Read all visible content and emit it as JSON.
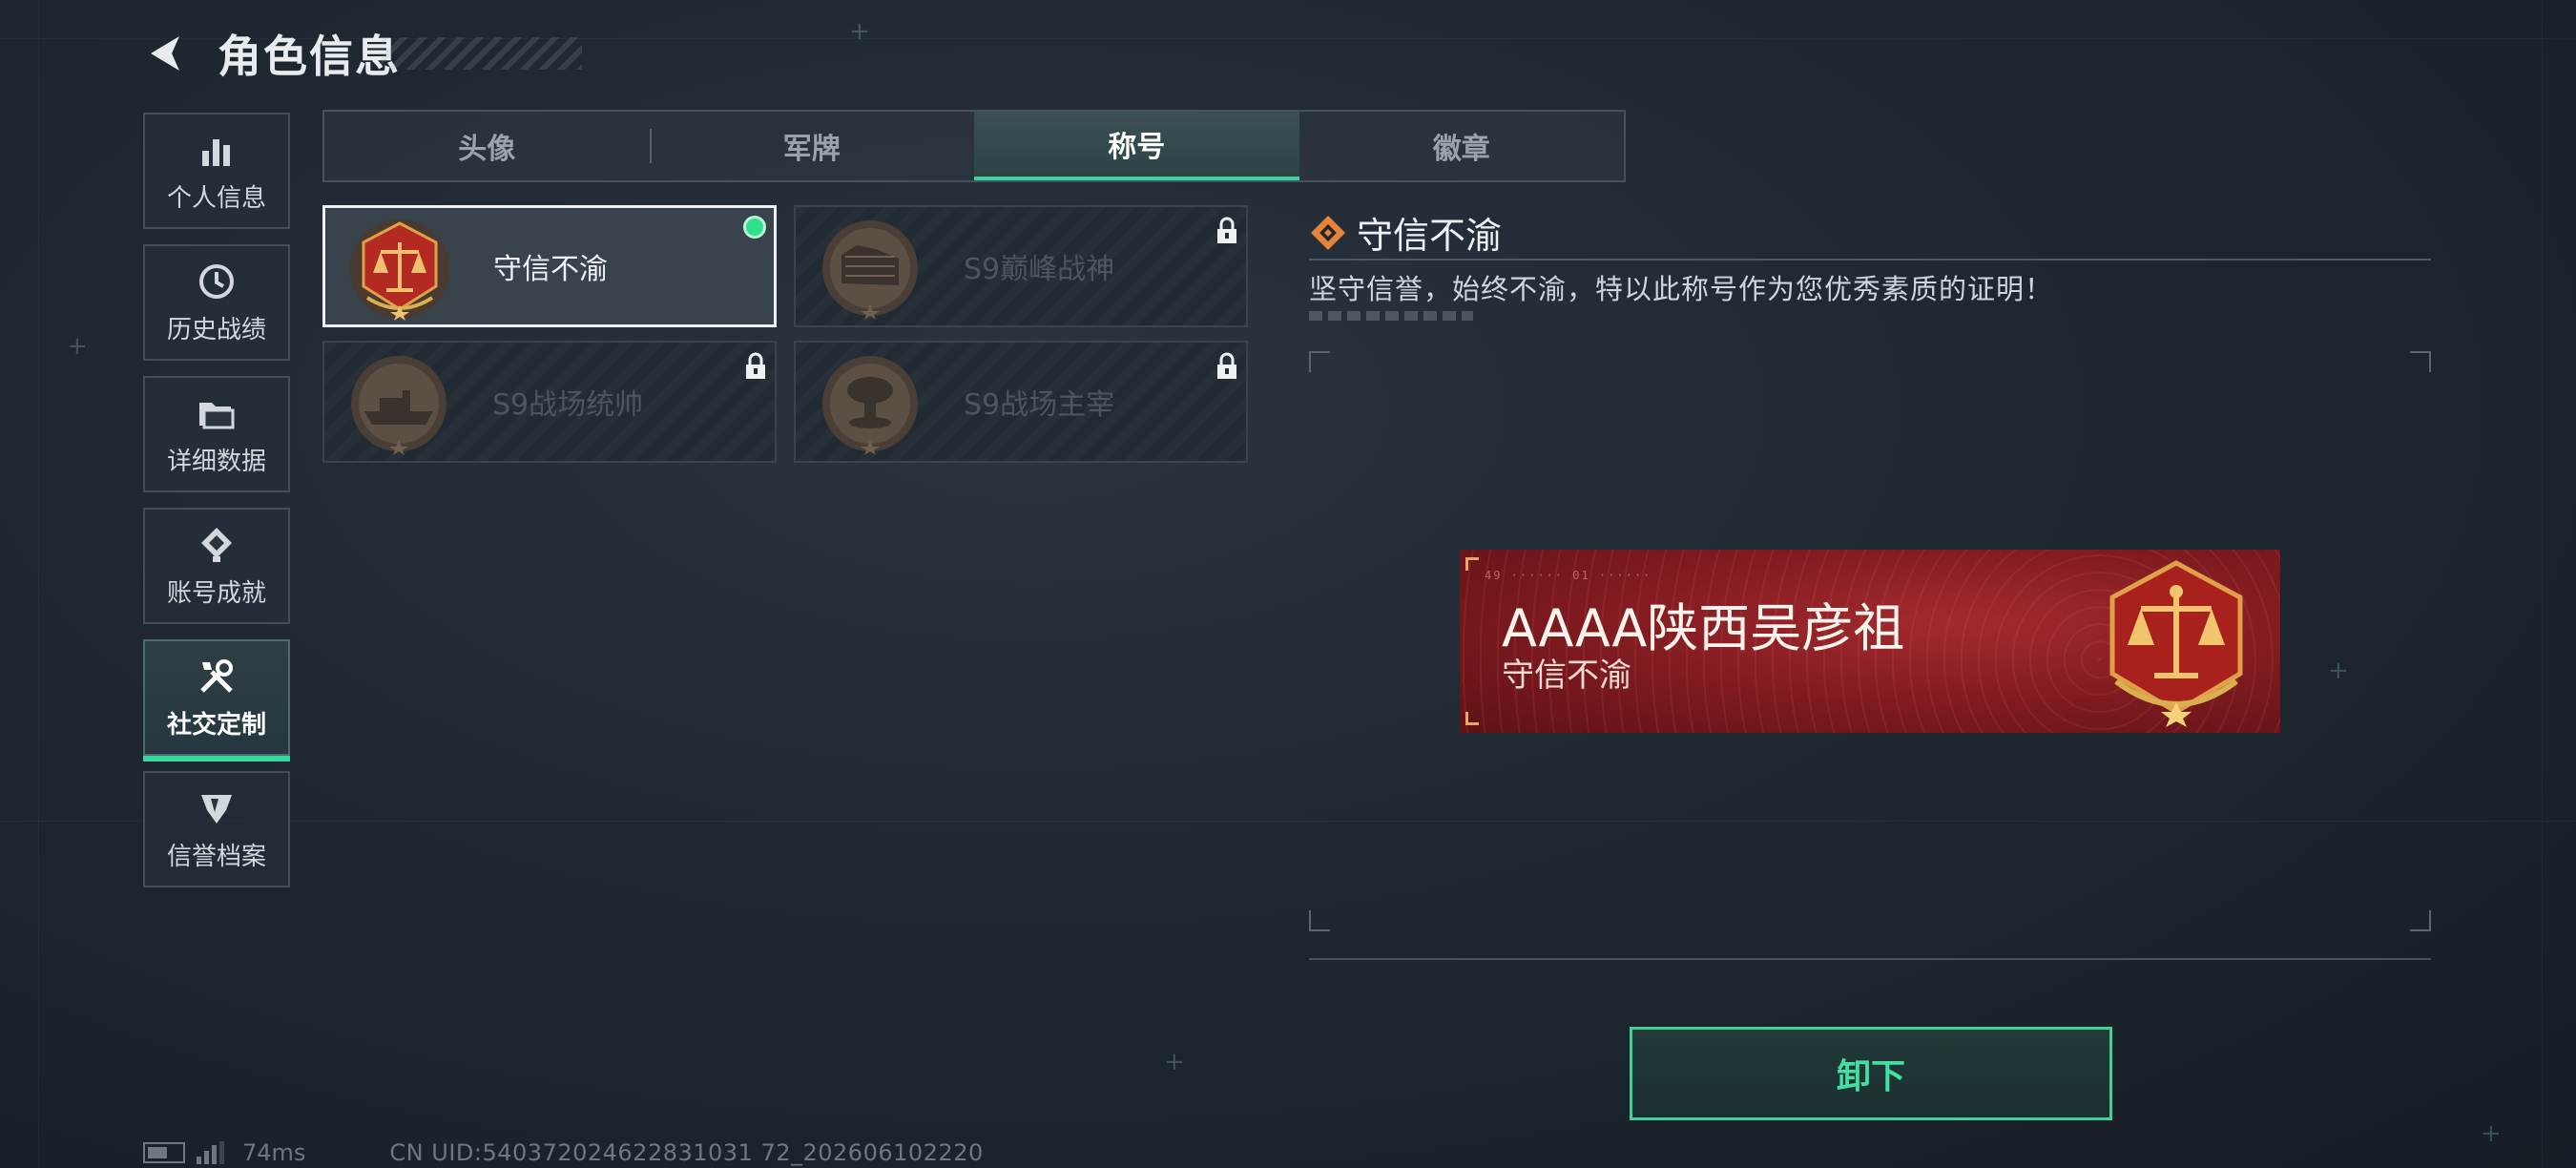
{
  "header": {
    "title": "角色信息"
  },
  "sidebar": {
    "items": [
      {
        "label": "个人信息",
        "icon": "bar-chart-icon"
      },
      {
        "label": "历史战绩",
        "icon": "history-clock-icon"
      },
      {
        "label": "详细数据",
        "icon": "folder-icon"
      },
      {
        "label": "账号成就",
        "icon": "achievement-icon"
      },
      {
        "label": "社交定制",
        "icon": "tools-icon",
        "active": true
      },
      {
        "label": "信誉档案",
        "icon": "credit-badge-icon"
      }
    ]
  },
  "tabs": [
    {
      "label": "头像"
    },
    {
      "label": "军牌"
    },
    {
      "label": "称号",
      "active": true
    },
    {
      "label": "徽章"
    }
  ],
  "titles": [
    {
      "name": "守信不渝",
      "selected": true,
      "equipped": true,
      "locked": false,
      "icon": "scales-emblem-icon"
    },
    {
      "name": "S9巅峰战神",
      "selected": false,
      "equipped": false,
      "locked": true,
      "icon": "fortress-emblem-icon"
    },
    {
      "name": "S9战场统帅",
      "selected": false,
      "equipped": false,
      "locked": true,
      "icon": "warship-emblem-icon"
    },
    {
      "name": "S9战场主宰",
      "selected": false,
      "equipped": false,
      "locked": true,
      "icon": "mushroom-cloud-emblem-icon"
    }
  ],
  "detail": {
    "title": "守信不渝",
    "description": "坚守信誉，始终不渝，特以此称号作为您优秀素质的证明！"
  },
  "preview": {
    "player_name": "AAAA陕西吴彦祖",
    "title": "守信不渝",
    "tiny_code": "49 ······ 01 ······"
  },
  "actions": {
    "unequip_label": "卸下"
  },
  "status": {
    "ping": "74ms",
    "uid": "CN UID:540372024622831031 72_202606102220"
  },
  "colors": {
    "accent": "#39d49e",
    "nameplate_red": "#a32a2e",
    "emblem_gold": "#e0a04a"
  }
}
